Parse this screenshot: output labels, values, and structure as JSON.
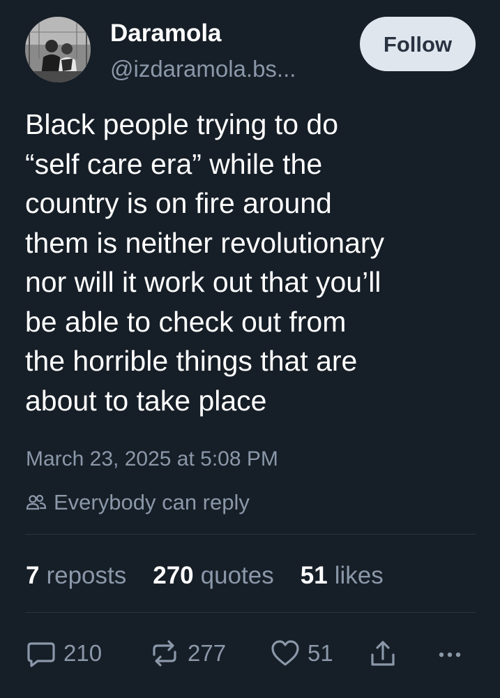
{
  "author": {
    "display_name": "Daramola",
    "handle": "@izdaramola.bs..."
  },
  "follow_label": "Follow",
  "post": {
    "lines": [
      "Black people trying to do",
      "“self care era” while the",
      "country is on fire around",
      "them is neither revolutionary",
      "nor will it work out that you’ll",
      "be able to check out from",
      "the horrible things that are",
      "about to take place"
    ],
    "timestamp": "March 23, 2025 at 5:08 PM",
    "reply_setting": "Everybody can reply"
  },
  "stats": {
    "reposts": {
      "count": "7",
      "label": "reposts"
    },
    "quotes": {
      "count": "270",
      "label": "quotes"
    },
    "likes": {
      "count": "51",
      "label": "likes"
    }
  },
  "actions": {
    "replies": "210",
    "reposts": "277",
    "likes": "51"
  },
  "icons": {
    "reply_setting": "people-icon",
    "reply": "comment-icon",
    "repost": "repost-icon",
    "like": "heart-icon",
    "share": "share-icon",
    "more": "more-icon"
  },
  "colors": {
    "background": "#161e27",
    "text": "#ffffff",
    "muted": "#8b98a9",
    "follow_bg": "#dfe6ee",
    "follow_text": "#283240"
  }
}
